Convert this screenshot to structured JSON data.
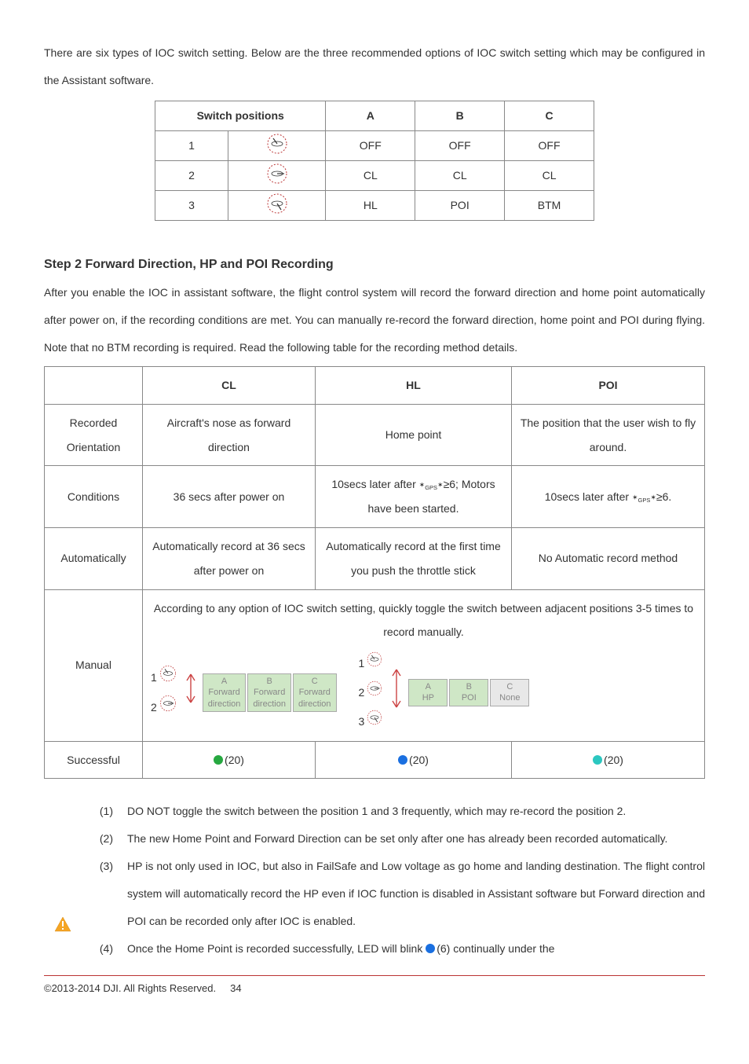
{
  "intro": "There are six types of IOC switch setting. Below are the three recommended options of IOC switch setting which may be configured in the Assistant software.",
  "table1": {
    "h_switch": "Switch positions",
    "h_a": "A",
    "h_b": "B",
    "h_c": "C",
    "r1_num": "1",
    "r2_num": "2",
    "r3_num": "3",
    "r1_a": "OFF",
    "r1_b": "OFF",
    "r1_c": "OFF",
    "r2_a": "CL",
    "r2_b": "CL",
    "r2_c": "CL",
    "r3_a": "HL",
    "r3_b": "POI",
    "r3_c": "BTM"
  },
  "step_title": "Step 2 Forward Direction, HP and POI Recording",
  "step_para": "After you enable the IOC in assistant software, the flight control system will record the forward direction and home point automatically after power on, if the recording conditions are met. You can manually re-record the forward direction, home point and POI during flying. Note that no BTM recording is required. Read the following table for the recording method details.",
  "table2": {
    "head_cl": "CL",
    "head_hl": "HL",
    "head_poi": "POI",
    "row1_lab": "Recorded Orientation",
    "row1_cl": "Aircraft's nose as forward direction",
    "row1_hl": "Home point",
    "row1_poi": "The position that the user wish to fly around.",
    "row2_lab": "Conditions",
    "row2_cl": "36 secs after power on",
    "row2_hl_pre": "10secs later after ",
    "row2_hl_gps": "GPS",
    "row2_hl_post": "≥6; Motors have been started.",
    "row2_poi_pre": "10secs later after ",
    "row2_poi_gps": "GPS",
    "row2_poi_post": "≥6.",
    "row3_lab": "Automatically",
    "row3_cl": "Automatically record at 36 secs after power on",
    "row3_hl": "Automatically record at the first time you push the throttle stick",
    "row3_poi": "No Automatic record method",
    "row4_lab": "Manual",
    "row4_text": "According to any option of IOC switch setting, quickly toggle the switch between adjacent positions 3-5 times to record manually.",
    "dgL_1": "1",
    "dgL_2": "2",
    "dgR_1": "1",
    "dgR_2": "2",
    "dgR_3": "3",
    "boxL_a_t": "A",
    "boxL_a_b1": "Forward",
    "boxL_a_b2": "direction",
    "boxL_b_t": "B",
    "boxL_b_b1": "Forward",
    "boxL_b_b2": "direction",
    "boxL_c_t": "C",
    "boxL_c_b1": "Forward",
    "boxL_c_b2": "direction",
    "boxR_a_t": "A",
    "boxR_a_b": "HP",
    "boxR_b_t": "B",
    "boxR_b_b": "POI",
    "boxR_c_t": "C",
    "boxR_c_b": "None",
    "row5_lab": "Successful",
    "row5_cl": "(20)",
    "row5_hl": "(20)",
    "row5_poi": "(20)"
  },
  "notes": {
    "n1_num": "(1)",
    "n1_txt": "DO NOT toggle the switch between the position 1 and 3 frequently, which may re-record the position 2.",
    "n2_num": "(2)",
    "n2_txt": "The new Home Point and Forward Direction can be set only after one has already been recorded automatically.",
    "n3_num": "(3)",
    "n3_txt": "HP is not only used in IOC, but also in FailSafe and Low voltage as go home and landing destination. The flight control system will automatically record the HP even if IOC function is disabled in Assistant software but Forward direction and POI can be recorded only after IOC is enabled.",
    "n4_num": "(4)",
    "n4_txt_pre": "Once the Home Point is recorded successfully, LED will blink ",
    "n4_led": "(6)",
    "n4_txt_post": " continually under the"
  },
  "footer": {
    "copyright": "©2013-2014 DJI. All Rights Reserved.",
    "page": "34"
  }
}
